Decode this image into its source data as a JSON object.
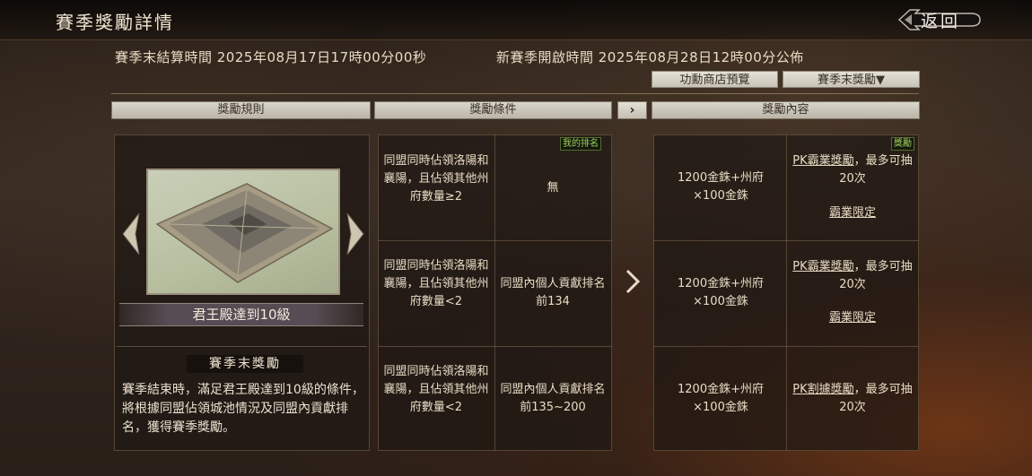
{
  "header": {
    "title": "賽季獎勵詳情",
    "back_label": "返回"
  },
  "times": {
    "settle": "賽季末結算時間 2025年08月17日17時00分00秒",
    "open": "新賽季開啟時間 2025年08月28日12時00分公佈"
  },
  "buttons": {
    "shop_preview": "功勳商店預覽",
    "season_reward": "賽季末獎勵▼"
  },
  "tabs": {
    "rules": "獎勵規則",
    "conditions": "獎勵條件",
    "contents": "獎勵內容",
    "arrow": "›"
  },
  "left": {
    "city_name": "君王殿達到10級",
    "sub_title": "賽季末獎勵",
    "description": "賽季結束時，滿足君王殿達到10級的條件，將根據同盟佔領城池情況及同盟內貢獻排名，獲得賽季獎勵。"
  },
  "tags": {
    "my_rank": "我的排名",
    "reward": "獎勵"
  },
  "rows": [
    {
      "condition": "同盟同時佔領洛陽和襄陽，且佔領其他州府數量≥2",
      "rank": "無",
      "reward": "1200金銖+州府×100金銖",
      "pk_link": "PK霸業獎勵",
      "pk_rest": "，最多可抽20次",
      "limit": "霸業限定"
    },
    {
      "condition": "同盟同時佔領洛陽和襄陽，且佔領其他州府數量<2",
      "rank": "同盟內個人貢獻排名前134",
      "reward": "1200金銖+州府×100金銖",
      "pk_link": "PK霸業獎勵",
      "pk_rest": "，最多可抽20次",
      "limit": "霸業限定"
    },
    {
      "condition": "同盟同時佔領洛陽和襄陽，且佔領其他州府數量<2",
      "rank": "同盟內個人貢獻排名前135~200",
      "reward": "1200金銖+州府×100金銖",
      "pk_link": "PK割據獎勵",
      "pk_rest": "，最多可抽20次",
      "limit": ""
    }
  ],
  "icons": {
    "back": "back-icon",
    "left_arrow": "chevron-left-icon",
    "right_arrow": "chevron-right-icon",
    "next": "chevron-right-icon"
  }
}
